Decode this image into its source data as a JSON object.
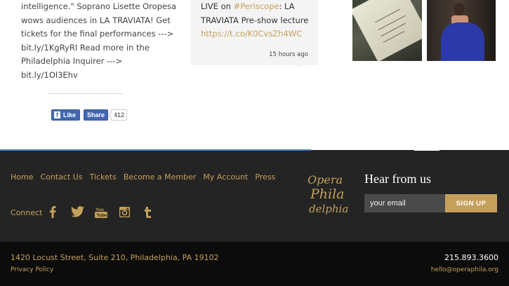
{
  "facebook_post": {
    "lines": [
      "intelligence.\" Soprano Lisette Oropesa",
      "wows audiences in LA TRAVIATA! Get",
      "tickets for the final performances --->",
      "bit.ly/1KgRyRI Read more in the",
      "Philadelphia Inquirer --->",
      "bit.ly/1Ol3Ehv"
    ],
    "like_label": "Like",
    "share_label": "Share",
    "share_count": "412"
  },
  "tweet": {
    "line1_prefix": "LIVE on ",
    "hashtag": "#Periscope",
    "line1_suffix": ": LA",
    "line2": "TRAVIATA Pre-show lecture",
    "link": "https://t.co/K0CvsZh4WC",
    "time": "15 hours ago"
  },
  "nav": {
    "items": [
      "Home",
      "Contact Us",
      "Tickets",
      "Become a Member",
      "My Account",
      "Press"
    ]
  },
  "connect": {
    "label": "Connect",
    "icons": [
      "facebook-icon",
      "twitter-icon",
      "youtube-icon",
      "instagram-icon",
      "tumblr-icon"
    ]
  },
  "logo": {
    "line1": "Opera",
    "line2": "Phila",
    "line3": "delphia"
  },
  "newsletter": {
    "heading": "Hear from us",
    "placeholder": "your email",
    "button": "SIGN UP"
  },
  "footer_bottom": {
    "address": "1420 Locust Street, Suite 210, Philadelphia, PA 19102",
    "privacy": "Privacy Policy",
    "phone": "215.893.3600",
    "email": "hello@operaphila.org"
  },
  "colors": {
    "gold": "#c5a05b",
    "footer_dark": "#242424",
    "footer_black": "#0c0c0c",
    "facebook_blue": "#4267b2"
  }
}
